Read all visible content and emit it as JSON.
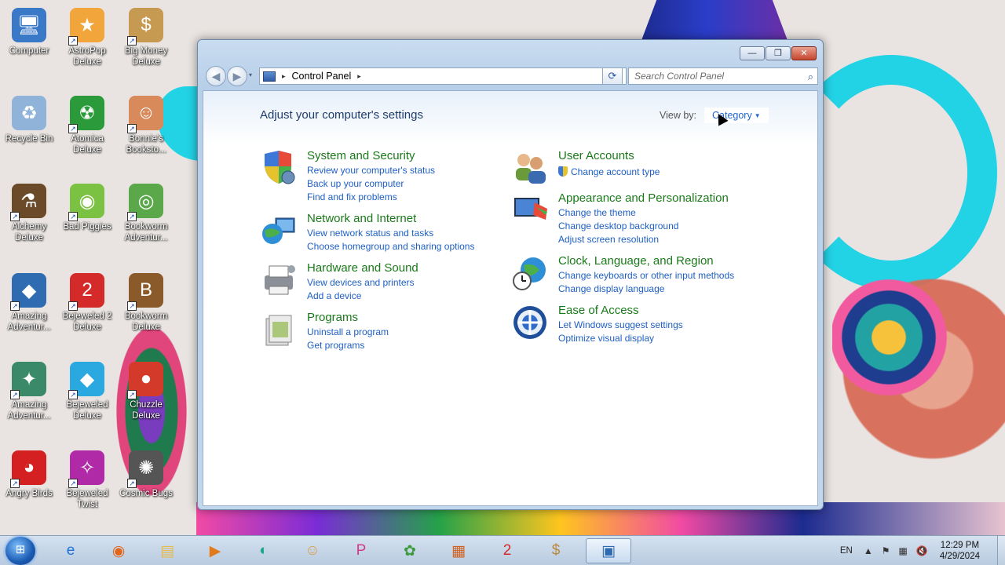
{
  "desktop": {
    "icons": [
      {
        "label": "Computer",
        "icon": "computer-icon",
        "color": "#3a78c8",
        "glyph": "🖥"
      },
      {
        "label": "AstroPop Deluxe",
        "icon": "astropop-icon",
        "color": "#f2a53a",
        "glyph": "★"
      },
      {
        "label": "Big Money Deluxe",
        "icon": "money-bag-icon",
        "color": "#c79a52",
        "glyph": "$"
      },
      {
        "label": "Recycle Bin",
        "icon": "recycle-bin-icon",
        "color": "#8fb3d9",
        "glyph": "♻"
      },
      {
        "label": "Atomica Deluxe",
        "icon": "atomica-icon",
        "color": "#2a9a3a",
        "glyph": "☢"
      },
      {
        "label": "Bonnie's Booksto...",
        "icon": "bonnie-icon",
        "color": "#d88a5a",
        "glyph": "☺"
      },
      {
        "label": "Alchemy Deluxe",
        "icon": "alchemy-icon",
        "color": "#6b4a2a",
        "glyph": "⚗"
      },
      {
        "label": "Bad Piggies",
        "icon": "bad-piggies-icon",
        "color": "#7cc242",
        "glyph": "◉"
      },
      {
        "label": "Bookworm Adventur...",
        "icon": "bookworm-icon",
        "color": "#5aa84a",
        "glyph": "◎"
      },
      {
        "label": "Amazing Adventur...",
        "icon": "amazing-adventures-icon",
        "color": "#2f6bb0",
        "glyph": "◆"
      },
      {
        "label": "Bejeweled 2 Deluxe",
        "icon": "bejeweled-2-icon",
        "color": "#d42a2a",
        "glyph": "2"
      },
      {
        "label": "Bookworm Deluxe",
        "icon": "bookworm-deluxe-icon",
        "color": "#8a5a2a",
        "glyph": "B"
      },
      {
        "label": "Amazing Adventur...",
        "icon": "amazing-adventures-2-icon",
        "color": "#3a8a6a",
        "glyph": "✦"
      },
      {
        "label": "Bejeweled Deluxe",
        "icon": "bejeweled-icon",
        "color": "#2aa8e0",
        "glyph": "◆"
      },
      {
        "label": "Chuzzle Deluxe",
        "icon": "chuzzle-icon",
        "color": "#d43a2a",
        "glyph": "●"
      },
      {
        "label": "Angry Birds",
        "icon": "angry-birds-icon",
        "color": "#d42020",
        "glyph": "◕"
      },
      {
        "label": "Bejeweled Twist",
        "icon": "bejeweled-twist-icon",
        "color": "#b02aa8",
        "glyph": "✧"
      },
      {
        "label": "Cosmic Bugs",
        "icon": "cosmic-bugs-icon",
        "color": "#555555",
        "glyph": "✺"
      }
    ]
  },
  "window": {
    "controls": {
      "minimize": "—",
      "maximize": "❐",
      "close": "✕"
    },
    "nav": {
      "back": "◀",
      "forward": "▶",
      "history": "▾"
    },
    "address": {
      "sep": "▸",
      "crumb": "Control Panel",
      "crumb_sep": "▸",
      "dropdown": "▼"
    },
    "refresh": "⟳",
    "search": {
      "placeholder": "Search Control Panel",
      "icon": "⌕"
    },
    "heading": "Adjust your computer's settings",
    "view_by": {
      "label": "View by:",
      "value": "Category",
      "arrow": "▼"
    },
    "categories_left": [
      {
        "title": "System and Security",
        "icon": "shield-icon",
        "links": [
          "Review your computer's status",
          "Back up your computer",
          "Find and fix problems"
        ]
      },
      {
        "title": "Network and Internet",
        "icon": "network-globe-icon",
        "links": [
          "View network status and tasks",
          "Choose homegroup and sharing options"
        ]
      },
      {
        "title": "Hardware and Sound",
        "icon": "printer-icon",
        "links": [
          "View devices and printers",
          "Add a device"
        ]
      },
      {
        "title": "Programs",
        "icon": "programs-icon",
        "links": [
          "Uninstall a program",
          "Get programs"
        ]
      }
    ],
    "categories_right": [
      {
        "title": "User Accounts",
        "icon": "users-icon",
        "links": [
          "Change account type"
        ]
      },
      {
        "title": "Appearance and Personalization",
        "icon": "monitor-paint-icon",
        "links": [
          "Change the theme",
          "Change desktop background",
          "Adjust screen resolution"
        ]
      },
      {
        "title": "Clock, Language, and Region",
        "icon": "clock-globe-icon",
        "links": [
          "Change keyboards or other input methods",
          "Change display language"
        ]
      },
      {
        "title": "Ease of Access",
        "icon": "ease-of-access-icon",
        "links": [
          "Let Windows suggest settings",
          "Optimize visual display"
        ]
      }
    ]
  },
  "taskbar": {
    "start": "⊞",
    "items": [
      {
        "name": "internet-explorer-icon",
        "glyph": "e",
        "color": "#1e73d4"
      },
      {
        "name": "firefox-icon",
        "glyph": "◉",
        "color": "#e2651c"
      },
      {
        "name": "file-explorer-icon",
        "glyph": "▤",
        "color": "#e8b94a"
      },
      {
        "name": "media-player-icon",
        "glyph": "▶",
        "color": "#e07a1a"
      },
      {
        "name": "zuma-icon",
        "glyph": "◐",
        "color": "#1aa88a"
      },
      {
        "name": "game-character-icon",
        "glyph": "☺",
        "color": "#d8a050"
      },
      {
        "name": "peggle-icon",
        "glyph": "P",
        "color": "#d43a8a"
      },
      {
        "name": "plants-zombies-icon",
        "glyph": "✿",
        "color": "#3a9a3a"
      },
      {
        "name": "blocks-game-icon",
        "glyph": "▦",
        "color": "#d06020"
      },
      {
        "name": "bejeweled-2-taskbar-icon",
        "glyph": "2",
        "color": "#d42a2a"
      },
      {
        "name": "big-money-taskbar-icon",
        "glyph": "$",
        "color": "#b88a3a"
      },
      {
        "name": "control-panel-taskbar-icon",
        "glyph": "▣",
        "color": "#2f6bb0"
      }
    ],
    "tray": {
      "lang": "EN",
      "up_arrow": "▲",
      "flag": "⚑",
      "network": "▦",
      "volume": "🔇"
    },
    "clock": {
      "time": "12:29 PM",
      "date": "4/29/2024"
    }
  }
}
